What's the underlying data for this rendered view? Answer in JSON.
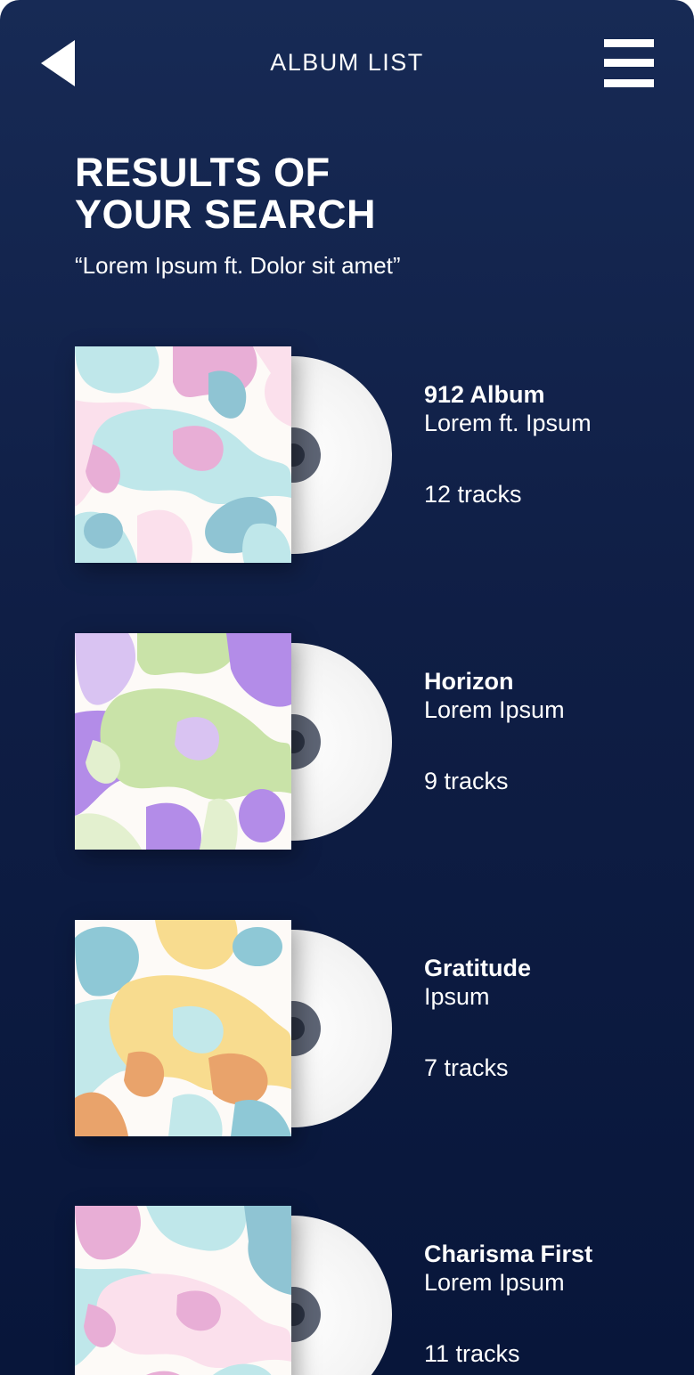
{
  "header": {
    "title": "ALBUM LIST",
    "back_icon": "back-arrow-icon",
    "menu_icon": "hamburger-menu-icon"
  },
  "search": {
    "heading_line1": "RESULTS OF",
    "heading_line2": "YOUR SEARCH",
    "query": "“Lorem Ipsum ft. Dolor sit amet”"
  },
  "albums": [
    {
      "title": "912 Album",
      "artist": "Lorem ft. Ipsum",
      "tracks": "12 tracks",
      "palette": [
        "#e8aed6",
        "#bfe7ea",
        "#8fc4d3",
        "#fbe0ec"
      ]
    },
    {
      "title": "Horizon",
      "artist": "Lorem Ipsum",
      "tracks": "9 tracks",
      "palette": [
        "#b38ce8",
        "#c9e3a8",
        "#e3f0cf",
        "#d9c3f2"
      ]
    },
    {
      "title": "Gratitude",
      "artist": "Ipsum",
      "tracks": "7 tracks",
      "palette": [
        "#8ec8d6",
        "#f8dc8f",
        "#e9a36b",
        "#c2e8ea"
      ]
    },
    {
      "title": "Charisma First",
      "artist": "Lorem Ipsum",
      "tracks": "11 tracks",
      "palette": [
        "#e8aed6",
        "#bfe7ea",
        "#8fc4d3",
        "#fbe0ec"
      ]
    }
  ],
  "colors": {
    "background_top": "#172a55",
    "background_bottom": "#08163a",
    "text": "#ffffff"
  }
}
